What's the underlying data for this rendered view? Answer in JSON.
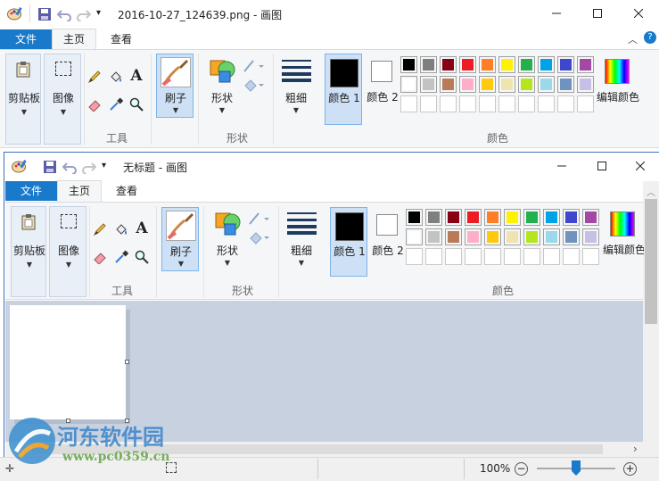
{
  "outer": {
    "title": "2016-10-27_124639.png - 画图",
    "tabs": {
      "file": "文件",
      "home": "主页",
      "view": "查看"
    },
    "groups": {
      "clipboard": "剪贴板",
      "image": "图像",
      "tools": "工具",
      "brushes": "刷子",
      "shapes_btn": "形状",
      "shapes_group": "形状",
      "size": "粗细",
      "color1": "颜色 1",
      "color2": "颜色 2",
      "colors_group": "颜色",
      "edit_colors": "编辑颜色"
    }
  },
  "inner": {
    "title": "无标题 - 画图",
    "tabs": {
      "file": "文件",
      "home": "主页",
      "view": "查看"
    },
    "groups": {
      "clipboard": "剪贴板",
      "image": "图像",
      "tools": "工具",
      "brushes": "刷子",
      "shapes_btn": "形状",
      "shapes_group": "形状",
      "size": "粗细",
      "color1": "颜色 1",
      "color2": "颜色 2",
      "colors_group": "颜色",
      "edit_colors": "编辑颜色"
    }
  },
  "palette": {
    "row1": [
      "#000000",
      "#7f7f7f",
      "#880015",
      "#ed1c24",
      "#ff7f27",
      "#fff200",
      "#22b14c",
      "#00a2e8",
      "#3f48cc",
      "#a349a4"
    ],
    "row2": [
      "#ffffff",
      "#c3c3c3",
      "#b97a57",
      "#ffaec9",
      "#ffc90e",
      "#efe4b0",
      "#b5e61d",
      "#99d9ea",
      "#7092be",
      "#c8bfe7"
    ],
    "row3": [
      "#ffffff",
      "#ffffff",
      "#ffffff",
      "#ffffff",
      "#ffffff",
      "#ffffff",
      "#ffffff",
      "#ffffff",
      "#ffffff",
      "#ffffff"
    ]
  },
  "colors": {
    "accent": "#1979ca",
    "color1": "#000000",
    "color2": "#ffffff",
    "workspace": "#c8d1e0"
  },
  "status": {
    "zoom": "100%"
  },
  "watermark": {
    "name": "河东软件园",
    "url": "www.pc0359.cn"
  }
}
